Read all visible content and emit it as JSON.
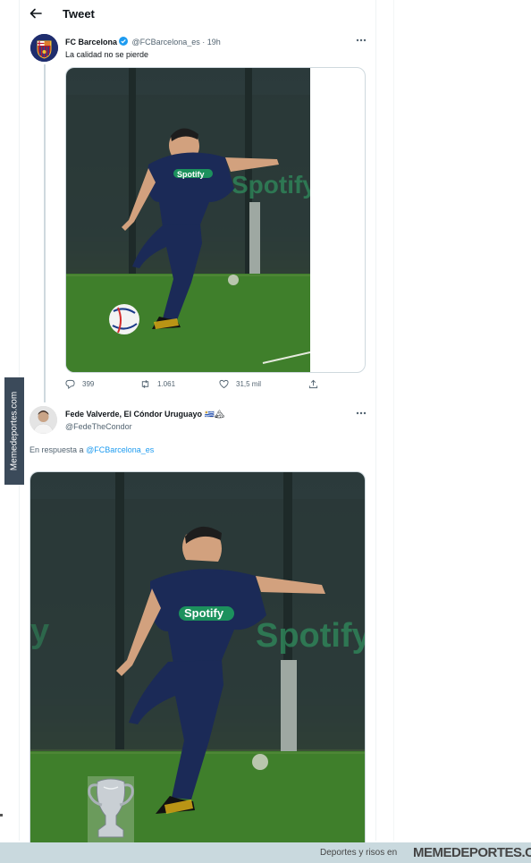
{
  "header": {
    "title": "Tweet"
  },
  "tweet": {
    "author_name": "FC Barcelona",
    "handle": "@FCBarcelona_es",
    "separator": "·",
    "time": "19h",
    "text": "La calidad no se pierde",
    "image_alt": "Player in navy training kit striking a football on grass",
    "kit_sponsor": "Spotify",
    "stats": {
      "replies": "399",
      "retweets": "1.061",
      "likes": "31,5 mil"
    }
  },
  "reply": {
    "author_name": "Fede Valverde, El Cóndor Uruguayo",
    "author_emoji": "🇺🇾🏔",
    "handle": "@FedeTheCondor",
    "reply_prefix": "En respuesta a",
    "reply_mention": "@FCBarcelona_es",
    "image_alt": "Same photo with a trophy added in the corner",
    "kit_sponsor": "Spotify"
  },
  "watermark": {
    "side": "Memedeportes.com",
    "slogan": "Deportes y risos en",
    "brand": "MEMEDEPORTES.COM"
  },
  "colors": {
    "accent": "#1d9bf0",
    "kit_navy": "#1b2a57",
    "pitch_green": "#3c7a2c"
  }
}
